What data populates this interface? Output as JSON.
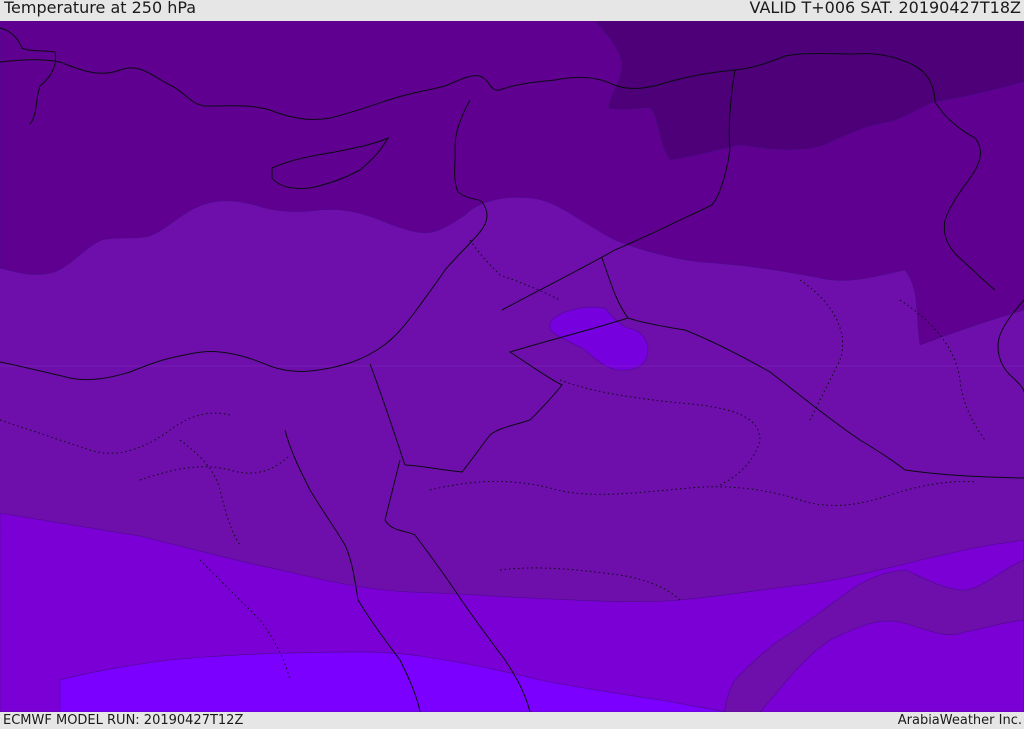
{
  "header": {
    "title": "Temperature at 250 hPa",
    "valid_time": "VALID T+006 SAT. 20190427T18Z"
  },
  "footer": {
    "model_run": "ECMWF MODEL RUN: 20190427T12Z",
    "credit": "ArabiaWeather Inc."
  },
  "colors": {
    "band_coldest": "#4e0078",
    "band_cold": "#5f0090",
    "band_mid": "#6f0fab",
    "band_warm": "#7a00d6",
    "band_warmest": "#7b00ff",
    "blob": "#7600de"
  }
}
